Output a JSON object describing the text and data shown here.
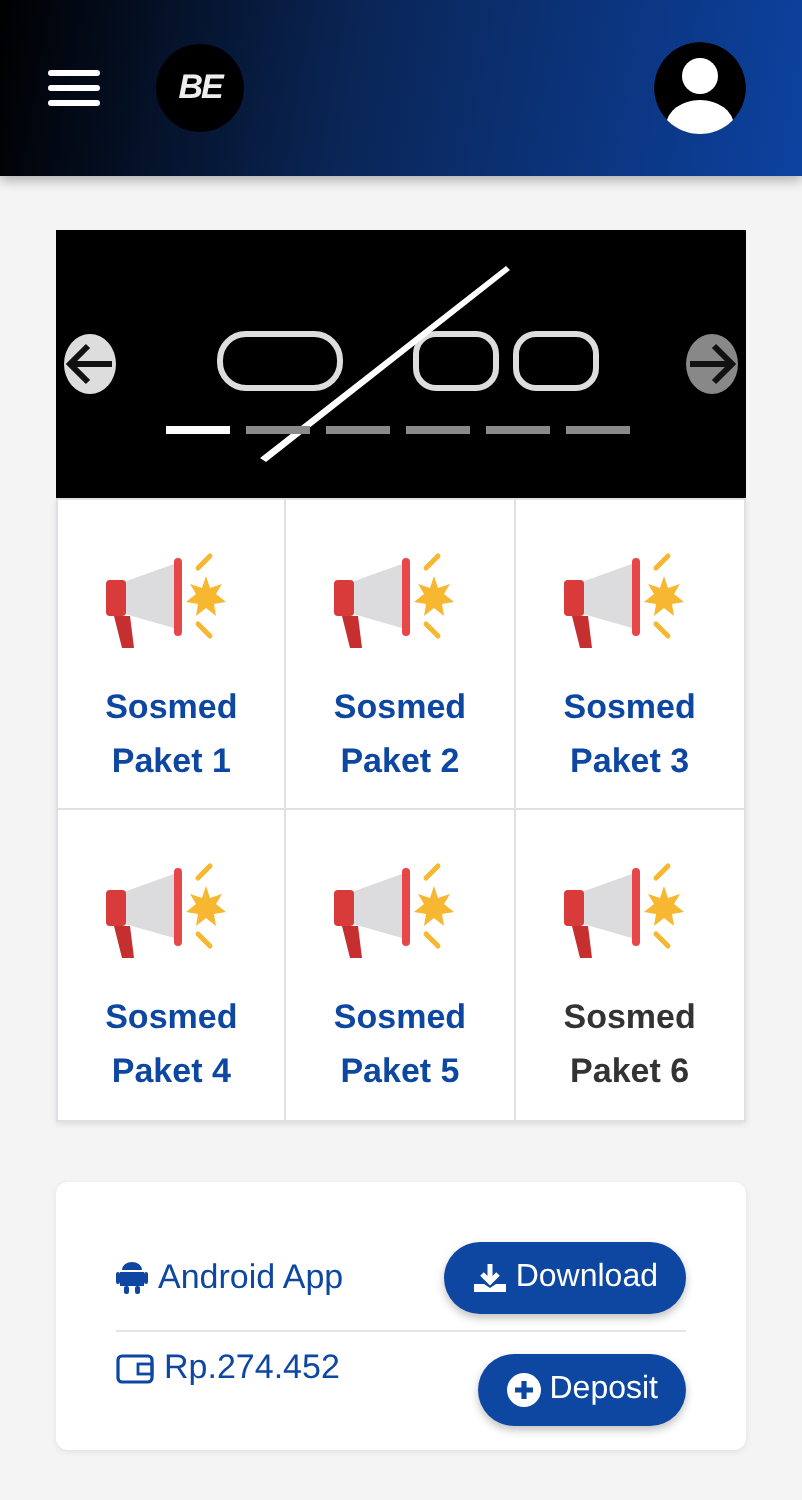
{
  "header": {
    "logo_text": "BE"
  },
  "carousel": {
    "slides": [
      {
        "selected": true
      },
      {
        "selected": false
      },
      {
        "selected": false
      },
      {
        "selected": false
      },
      {
        "selected": false
      },
      {
        "selected": false
      }
    ]
  },
  "packages": [
    {
      "line1": "Sosmed",
      "line2": "Paket 1",
      "active": false
    },
    {
      "line1": "Sosmed",
      "line2": "Paket 2",
      "active": false
    },
    {
      "line1": "Sosmed",
      "line2": "Paket 3",
      "active": false
    },
    {
      "line1": "Sosmed",
      "line2": "Paket 4",
      "active": false
    },
    {
      "line1": "Sosmed",
      "line2": "Paket 5",
      "active": false
    },
    {
      "line1": "Sosmed",
      "line2": "Paket 6",
      "active": true
    }
  ],
  "app": {
    "label": "Android App",
    "button": "Download"
  },
  "wallet": {
    "balance": "Rp.274.452",
    "button": "Deposit"
  }
}
